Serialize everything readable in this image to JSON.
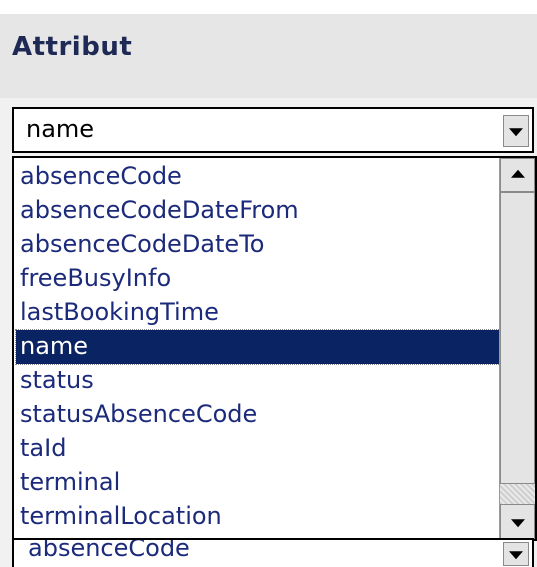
{
  "header": {
    "title": "Attribut"
  },
  "combo": {
    "value": "name"
  },
  "dropdown": {
    "options": [
      "absenceCode",
      "absenceCodeDateFrom",
      "absenceCodeDateTo",
      "freeBusyInfo",
      "lastBookingTime",
      "name",
      "status",
      "statusAbsenceCode",
      "taId",
      "terminal",
      "terminalLocation"
    ],
    "selected": "name"
  },
  "combo2": {
    "value": "absenceCode"
  },
  "colors": {
    "selection": "#0a2463",
    "option_text": "#1b2a7a",
    "panel": "#e9e9e9"
  }
}
